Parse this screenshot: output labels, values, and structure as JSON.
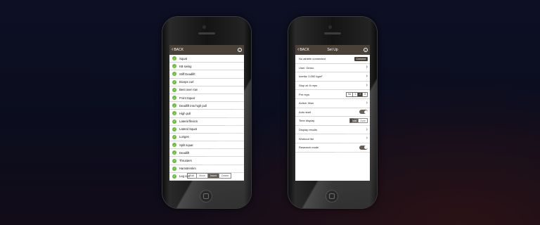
{
  "left_screen": {
    "back_label": "BACK",
    "info_label": "i",
    "exercises": [
      "Squat",
      "KB swing",
      "Stiff Deadlift",
      "Biceps curl",
      "Bent over row",
      "Front Squat",
      "Deadlift into high pull",
      "High pull",
      "Lateral flexion",
      "Lateral Squat",
      "Lunges",
      "Split squat",
      "Deadlift",
      "Thrusters",
      "Hamstrenkm",
      "Leg curl"
    ],
    "segments": [
      "Edit",
      "Move",
      "Insert",
      "Delete"
    ],
    "selected_segment": "Insert"
  },
  "right_screen": {
    "back_label": "BACK",
    "title": "Set Up",
    "info_label": "i",
    "rows": [
      {
        "label": "No athlete connected",
        "control": "button",
        "button": "Connect"
      },
      {
        "label": "User: Demo",
        "control": "arrow"
      },
      {
        "label": "Inertia: 0,050 kgm²",
        "control": "arrow"
      },
      {
        "label": "Stop at: 6 reps",
        "control": "arrow"
      },
      {
        "label": "Pre reps",
        "control": "segment",
        "options": [
          "No",
          "1",
          "2",
          "3"
        ],
        "selected": "2"
      },
      {
        "label": "Active: Man",
        "control": "arrow"
      },
      {
        "label": "Auto start",
        "control": "toggle",
        "state": "on"
      },
      {
        "label": "Time display",
        "control": "segment",
        "options": [
          "Total",
          "Zone"
        ],
        "selected": "Total"
      },
      {
        "label": "Display results",
        "control": "arrow"
      },
      {
        "label": "Workout list",
        "control": "arrow"
      },
      {
        "label": "Research mode",
        "control": "toggle",
        "state": "on"
      }
    ]
  },
  "icons": {
    "back": "chevron-left-icon",
    "info": "info-icon",
    "check": "check-icon",
    "arrow": "chevron-right-icon"
  },
  "colors": {
    "accent": "#4a4239",
    "check": "#6dbb3e"
  }
}
